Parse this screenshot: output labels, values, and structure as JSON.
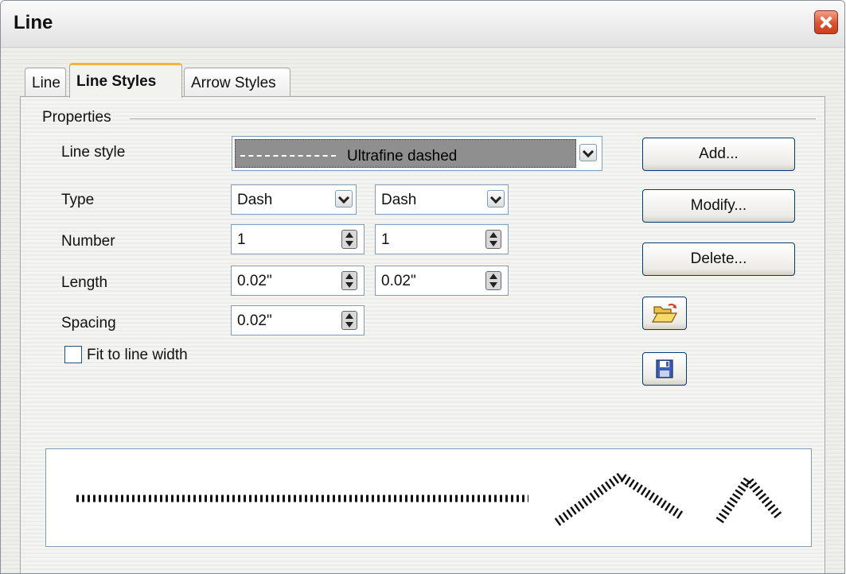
{
  "window": {
    "title": "Line"
  },
  "tabs": [
    {
      "label": "Line"
    },
    {
      "label": "Line Styles"
    },
    {
      "label": "Arrow Styles"
    }
  ],
  "properties": {
    "legend": "Properties",
    "line_style": {
      "label": "Line style",
      "value": "Ultrafine dashed"
    },
    "type": {
      "label": "Type",
      "value1": "Dash",
      "value2": "Dash"
    },
    "number": {
      "label": "Number",
      "value1": "1",
      "value2": "1"
    },
    "length": {
      "label": "Length",
      "value1": "0.02\"",
      "value2": "0.02\""
    },
    "spacing": {
      "label": "Spacing",
      "value1": "0.02\""
    },
    "fit_to_line_width": {
      "label": "Fit to line width",
      "checked": false
    }
  },
  "buttons": {
    "add": "Add...",
    "modify": "Modify...",
    "delete": "Delete..."
  },
  "icons": {
    "open": "folder-open-icon",
    "save": "floppy-disk-icon",
    "close": "close-icon"
  }
}
